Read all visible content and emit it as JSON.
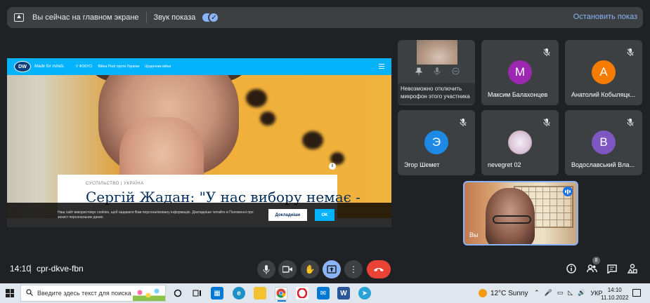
{
  "banner": {
    "presenting_text": "Вы сейчас на главном экране",
    "sound_label": "Звук показа",
    "stop_label": "Остановить показ"
  },
  "shared_screen": {
    "logo": "DW",
    "slogan": "Made for minds.",
    "nav": [
      "У ФОКУСІ",
      "Війна Росії проти України",
      "Щоденник війни"
    ],
    "category": "СУСПІЛЬСТВО | УКРАЇНА",
    "headline": "Сергій Жадан: \"У нас вибору немає -",
    "cookie_text": "Наш сайт використовує cookies, щоб надавати Вам персоналізовану інформацію. Докладніше читайте в Положенні про захист персональних даних.",
    "cookie_more": "Докладніше",
    "cookie_ok": "OK",
    "info": "i"
  },
  "participants": [
    {
      "name": "",
      "tooltip": "Невозможно отключить микрофон этого участника",
      "muted": false
    },
    {
      "name": "Максим Балахонцев",
      "initial": "М",
      "color": "#9c27b0",
      "muted": true
    },
    {
      "name": "Анатолий Кобыляцк...",
      "initial": "А",
      "color": "#f57c00",
      "muted": true
    },
    {
      "name": "Эгор Шемет",
      "initial": "Э",
      "color": "#1e88e5",
      "muted": true
    },
    {
      "name": "nevegret 02",
      "initial": "",
      "color": "#e8e0e8",
      "muted": true
    },
    {
      "name": "Водославський Вла...",
      "initial": "В",
      "color": "#7e57c2",
      "muted": true
    }
  ],
  "self_view": {
    "name": "Вы"
  },
  "meeting": {
    "time": "14:10",
    "code": "cpr-dkve-fbn",
    "participant_count": "8"
  },
  "taskbar": {
    "search_placeholder": "Введите здесь текст для поиска",
    "weather": "12°C  Sunny",
    "lang": "УКР",
    "clock_time": "14:10",
    "clock_date": "11.10.2022"
  }
}
